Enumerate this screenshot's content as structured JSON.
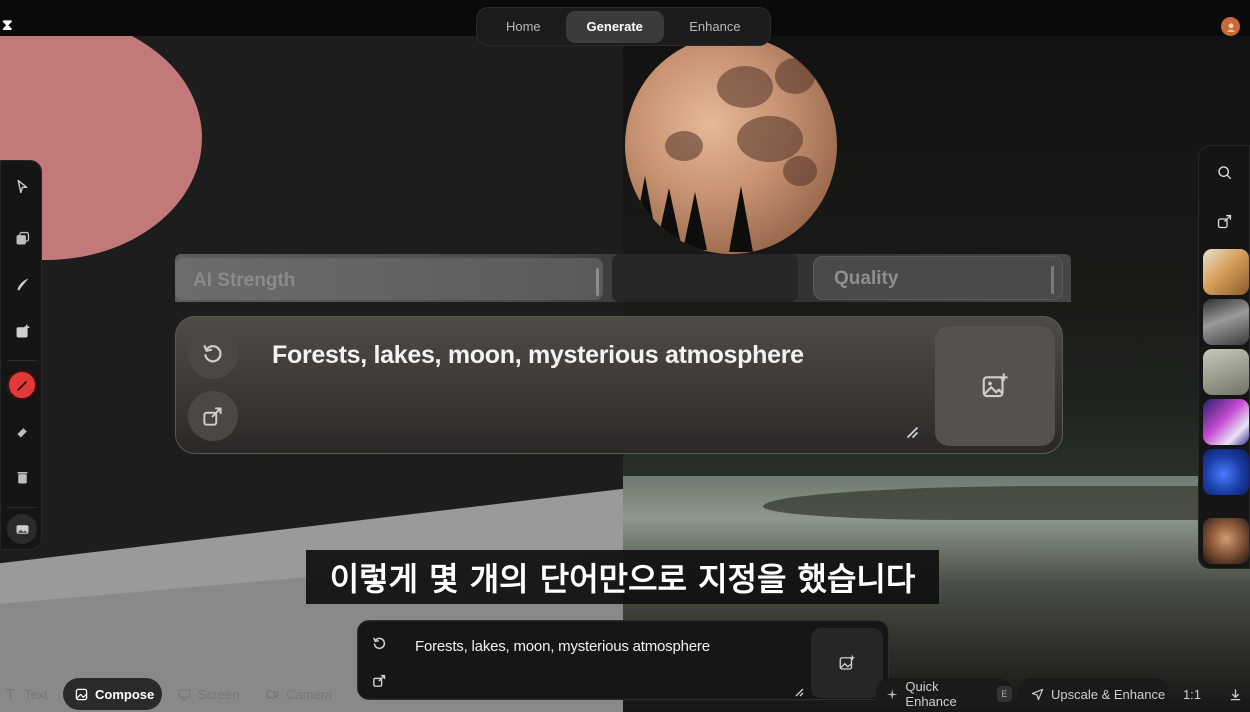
{
  "app": {
    "logo_glyph": "⧗",
    "accent_color": "#e23a3a"
  },
  "header": {
    "tabs": [
      {
        "label": "Home",
        "active": false
      },
      {
        "label": "Generate",
        "active": true
      },
      {
        "label": "Enhance",
        "active": false
      }
    ],
    "avatar_icon": "user-avatar-icon"
  },
  "left_toolbar": {
    "tools": [
      "pointer-icon",
      "layers-icon",
      "brush-icon",
      "add-image-icon",
      "paint-brush-icon",
      "eraser-icon",
      "trash-icon",
      "gallery-icon"
    ],
    "active_tool": "paint-brush-icon"
  },
  "right_toolbar": {
    "tools": [
      "search-icon",
      "share-icon"
    ],
    "thumbnail_count": 6
  },
  "controls": {
    "ai_strength_label": "AI Strength",
    "quality_label": "Quality"
  },
  "prompt": {
    "text": "Forests, lakes, moon, mysterious atmosphere"
  },
  "subtitle": {
    "text": "이렇게 몇 개의 단어만으로 지정을 했습니다"
  },
  "mini_prompt": {
    "text": "Forests, lakes, moon, mysterious atmosphere"
  },
  "bottom_bar": {
    "text_label": "Text",
    "compose_label": "Compose",
    "screen_label": "Screen",
    "camera_label": "Camera",
    "quick_enhance_label": "Quick Enhance",
    "quick_enhance_key": "E",
    "upscale_label": "Upscale & Enhance",
    "ratio_label": "1:1"
  }
}
